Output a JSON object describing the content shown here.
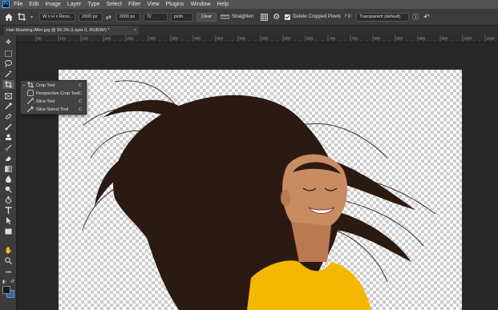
{
  "menu": {
    "logo": "Ps",
    "items": [
      "File",
      "Edit",
      "Image",
      "Layer",
      "Type",
      "Select",
      "Filter",
      "View",
      "Plugins",
      "Window",
      "Help"
    ]
  },
  "options": {
    "ratio_select": "W x H x Reso...",
    "width_value": "2000 px",
    "height_value": "2000 px",
    "resolution_value": "72",
    "unit_select": "px/in",
    "clear_label": "Clear",
    "straighten_label": "Straighten",
    "delete_cropped_label": "Delete Cropped Pixels",
    "fill_label": "Fill:",
    "fill_select": "Transparent (default)"
  },
  "document": {
    "tab_title": "Hair-Masking-After.jpg @ 99.3% (Layer 0, RGB/8#) *",
    "close_glyph": "×"
  },
  "ruler": {
    "labels": [
      "50",
      "100",
      "150",
      "200",
      "250",
      "300",
      "350",
      "400",
      "450",
      "500",
      "550",
      "600",
      "650",
      "700",
      "750",
      "800",
      "850",
      "900",
      "950",
      "1000",
      "1050"
    ]
  },
  "flyout": {
    "items": [
      {
        "label": "Crop Tool",
        "key": "C",
        "icon": "crop-icon",
        "selected": true
      },
      {
        "label": "Perspective Crop Tool",
        "key": "C",
        "icon": "perspective-crop-icon",
        "selected": false
      },
      {
        "label": "Slice Tool",
        "key": "C",
        "icon": "slice-icon",
        "selected": false
      },
      {
        "label": "Slice Select Tool",
        "key": "C",
        "icon": "slice-select-icon",
        "selected": false
      }
    ]
  },
  "colors": {
    "foreground": "#1a1a1a",
    "background": "#1d6fb8",
    "accent": "#31a8ff"
  }
}
